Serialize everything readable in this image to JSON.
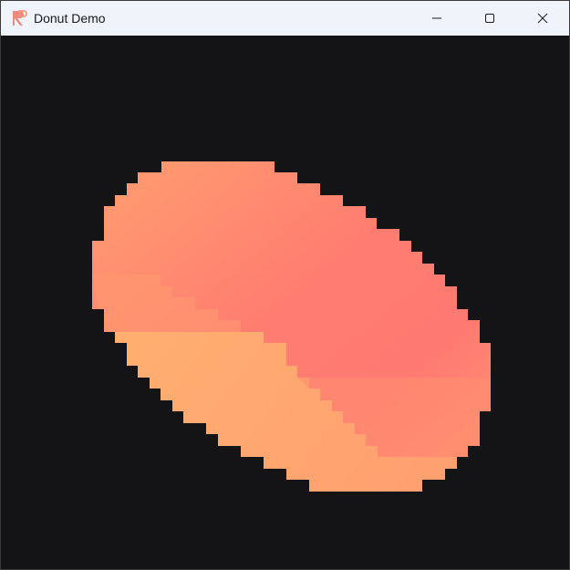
{
  "window": {
    "title": "Donut Demo",
    "app_icon": "app-logo-icon",
    "controls": {
      "minimize_icon": "minimize-icon",
      "maximize_icon": "maximize-icon",
      "close_icon": "close-icon"
    }
  },
  "viewport": {
    "background": "#141416",
    "shape_colors": {
      "top_surface": "#ff7a70",
      "top_edge": "#ffa070",
      "bottom_surface": "#ffb070"
    }
  }
}
